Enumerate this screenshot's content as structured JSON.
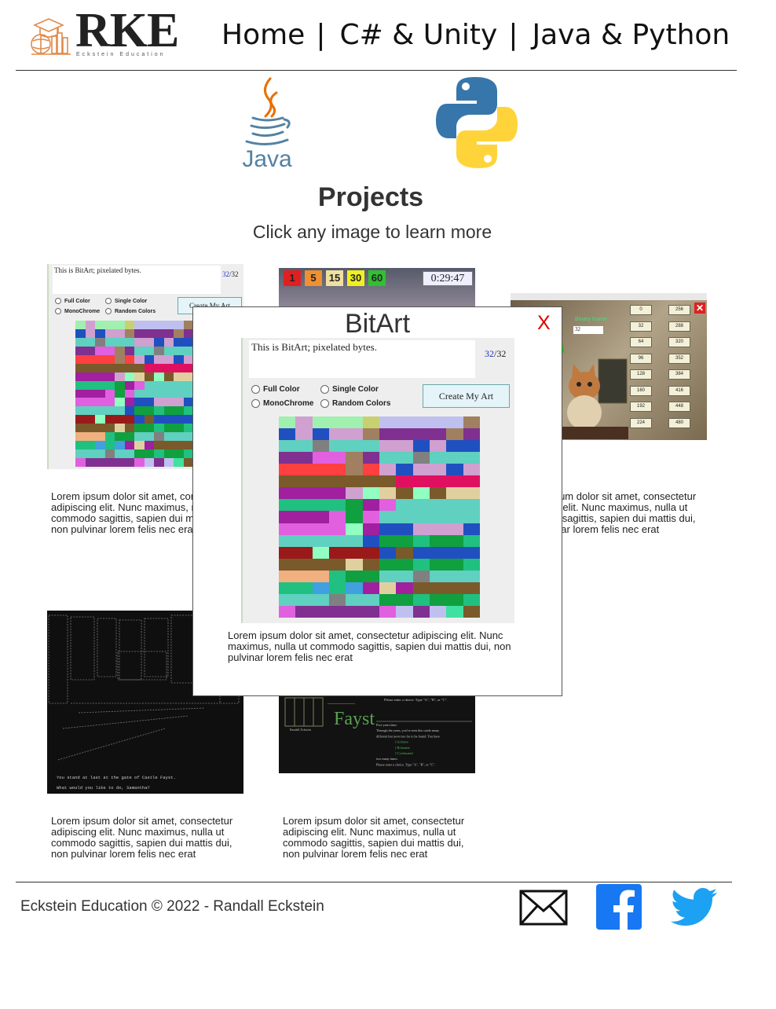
{
  "header": {
    "logo_text": "RKE",
    "logo_subtext": "Eckstein Education",
    "nav": [
      {
        "label": "Home"
      },
      {
        "label": "C# & Unity"
      },
      {
        "label": "Java & Python"
      }
    ],
    "nav_separator": "|"
  },
  "languages": {
    "java_label": "Java"
  },
  "main": {
    "title": "Projects",
    "subtitle": "Click any image to learn more"
  },
  "bitart_app": {
    "textarea_text": "This is BitArt; pixelated bytes.",
    "counter_current": "32",
    "counter_total": "/32",
    "options": [
      "Full Color",
      "Single Color",
      "MonoChrome",
      "Random Colors"
    ],
    "selected_option": "Full Color",
    "button_label": "Create My Art"
  },
  "timer_app": {
    "buttons": [
      "1",
      "5",
      "15",
      "30",
      "60"
    ],
    "timer": "0:29:47"
  },
  "binary_app": {
    "heading": "Binary Game",
    "input_value": "32",
    "left_values": [
      "0",
      "32",
      "64",
      "96",
      "128",
      "160",
      "192",
      "224"
    ],
    "right_values": [
      "256",
      "288",
      "320",
      "352",
      "384",
      "416",
      "448",
      "480"
    ]
  },
  "castle_app": {
    "line1": "You stand at last at the gate of Castle Fayst.",
    "line2": "What would you like to do, Samantha?"
  },
  "console_app": {
    "title_word": "Fayst",
    "prompt": "Please enter a choice.  Type \"A\", \"B\", or \"C\".",
    "lines": [
      "Five years later:",
      "Through the years, you've seen this castle many",
      "different but never too far to be found. You have",
      "] A) brave",
      "] B) honest",
      "] C) educated",
      "two many times.",
      "Please enter a choice.  Type \"A\", \"B\", or \"C\"."
    ],
    "author": "Randall Eckstein"
  },
  "cards": [
    {
      "description": "Lorem ipsum dolor sit amet, consectetur adipiscing elit. Nunc maximus, nulla ut commodo sagittis, sapien dui mattis dui, non pulvinar lorem felis nec erat"
    },
    {
      "description": "Lorem ipsum dolor sit amet, consectetur adipiscing elit. Nunc maximus, nulla ut commodo sagittis, sapien dui mattis dui, non pulvinar lorem felis nec erat"
    },
    {
      "description": "Lorem ipsum dolor sit amet, consectetur adipiscing elit. Nunc maximus, nulla ut commodo sagittis, sapien dui mattis dui, non pulvinar lorem felis nec erat"
    },
    {
      "description": "Lorem ipsum dolor sit amet, consectetur adipiscing elit. Nunc maximus, nulla ut commodo sagittis, sapien dui mattis dui, non pulvinar lorem felis nec erat"
    },
    {
      "description": "Lorem ipsum dolor sit amet, consectetur adipiscing elit. Nunc maximus, nulla ut commodo sagittis, sapien dui mattis dui, non pulvinar lorem felis nec erat"
    }
  ],
  "modal": {
    "title": "BitArt",
    "close_label": "X",
    "description": "Lorem ipsum dolor sit amet, consectetur adipiscing elit. Nunc maximus, nulla ut commodo sagittis, sapien dui mattis dui, non pulvinar lorem felis nec erat"
  },
  "footer": {
    "copyright": "Eckstein Education © 2022 - Randall Eckstein",
    "icons": [
      "mail-icon",
      "facebook-icon",
      "twitter-icon"
    ]
  },
  "colors": {
    "accent_orange": "#e08a4a",
    "close_red": "#e00000",
    "facebook_blue": "#1877f2",
    "twitter_blue": "#1da1f2",
    "python_blue": "#3776ab",
    "python_yellow": "#ffd43b",
    "java_orange": "#e76f00",
    "java_blue": "#5382a1"
  },
  "pixel_palette": [
    "#c8d070",
    "#2050c0",
    "#e060e0",
    "#803090",
    "#7a5a2a",
    "#40a0e0",
    "#f0b080",
    "#ff4040",
    "#20c080",
    "#40e0a0",
    "#a0f0b0",
    "#d0a0d0",
    "#a08060",
    "#e01060",
    "#1020f0",
    "#c0c0f0",
    "#60d0c0",
    "#808080",
    "#f080f0",
    "#10a040",
    "#e0d0a0",
    "#a020a0",
    "#90ffc0",
    "#9a1a1a"
  ],
  "pixel_rows": [
    "ABAAA0FFFFFC",
    "1B1BBC3333C3",
    "GGHGGGBB1B11",
    "3322C3GGHGGG",
    "7777C7B1BB1B",
    "4444444DDDDD",
    "LLLLBMK4M4KK",
    "8888JL2GGGGG",
    "LLL2J2GGGGGG",
    "2222ML11BBB1",
    "GGGGG1JJ8JJ8",
    "NNMNNNPSPPPP",
    "4444K4JJ8JJ8",
    "UUU8JJGGHGGG",
    "WWTWTLKL44S4",
    "GGGHGGJJ8JJ8",
    "2333332F3FX4"
  ]
}
